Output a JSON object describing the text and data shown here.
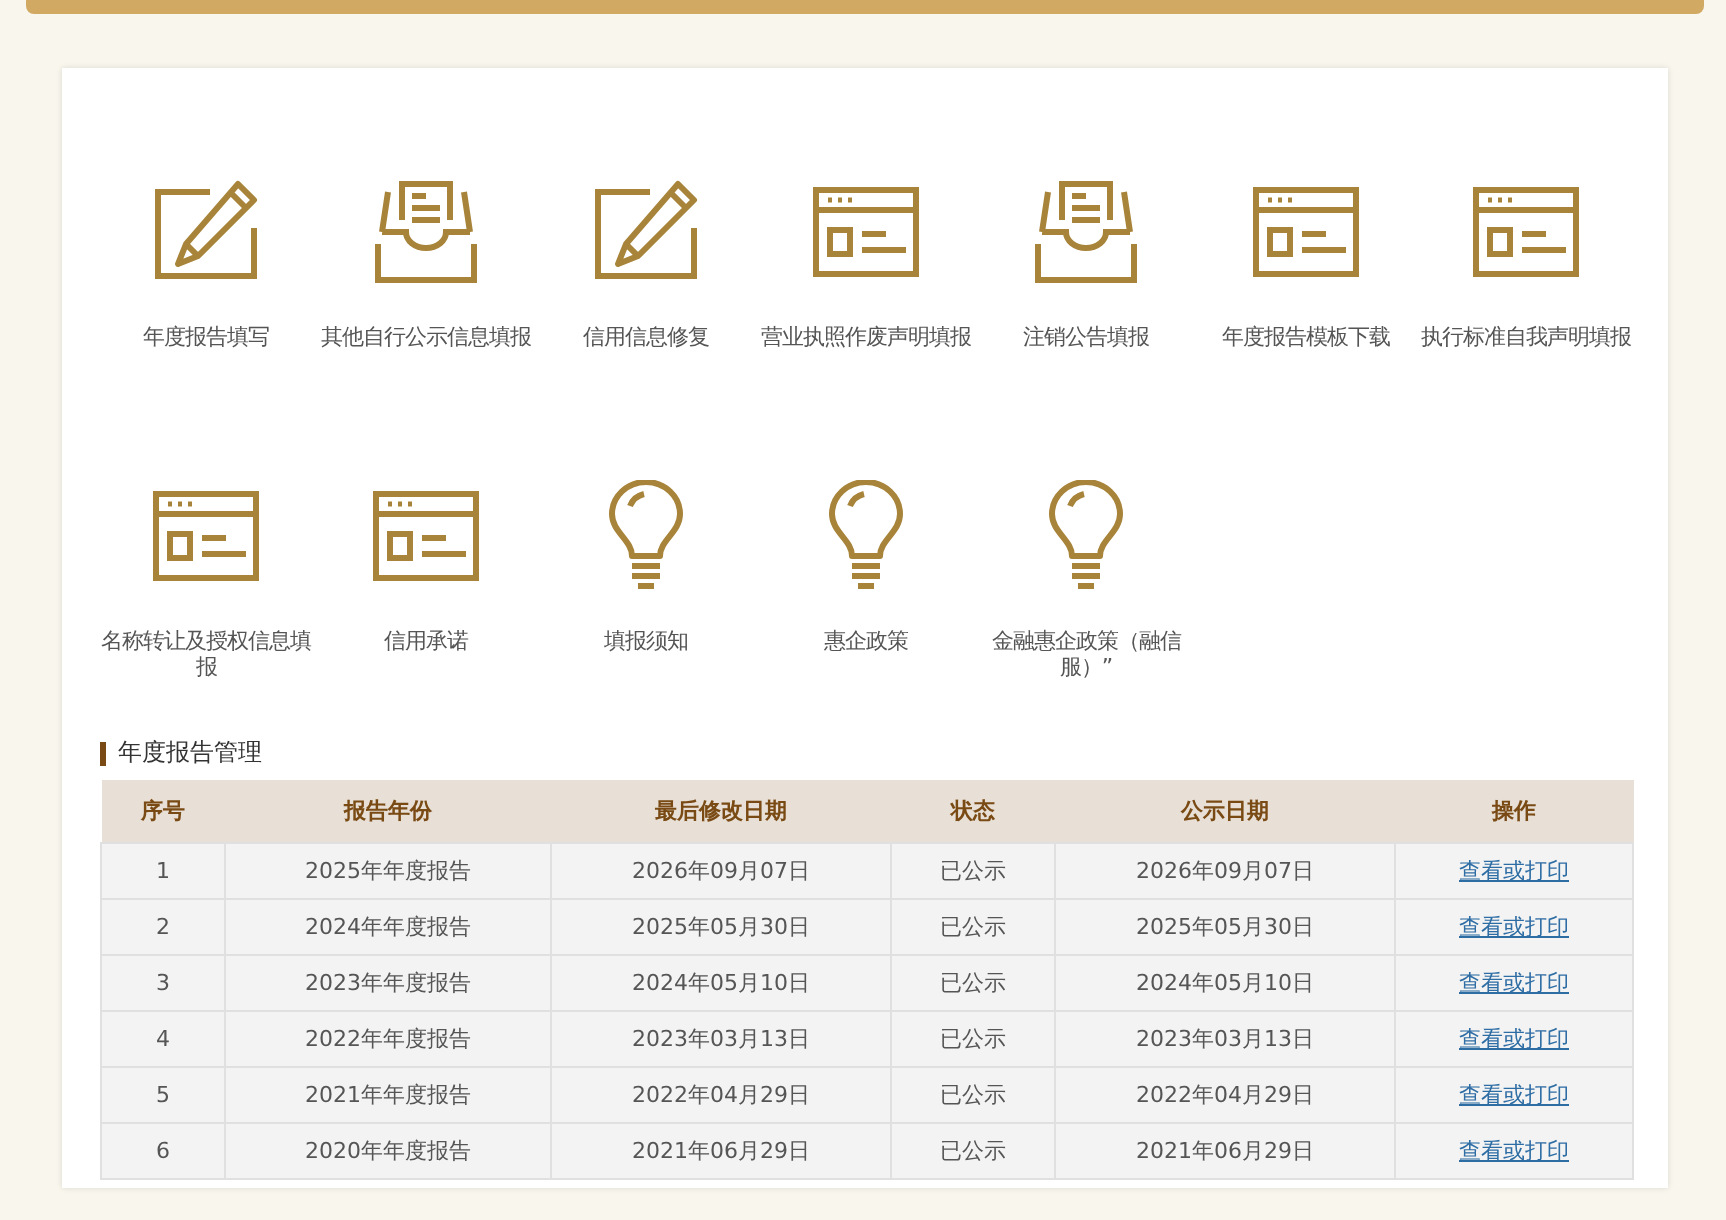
{
  "tiles": [
    {
      "kind": "edit",
      "label": "年度报告填写"
    },
    {
      "kind": "tray",
      "label": "其他自行公示信息填报"
    },
    {
      "kind": "edit",
      "label": "信用信息修复"
    },
    {
      "kind": "form",
      "label": "营业执照作废声明填报"
    },
    {
      "kind": "tray",
      "label": "注销公告填报"
    },
    {
      "kind": "form",
      "label": "年度报告模板下载"
    },
    {
      "kind": "form",
      "label": "执行标准自我声明填报"
    },
    {
      "kind": "form",
      "label": "名称转让及授权信息填报"
    },
    {
      "kind": "form",
      "label": "信用承诺"
    },
    {
      "kind": "bulb",
      "label": "填报须知"
    },
    {
      "kind": "bulb",
      "label": "惠企政策"
    },
    {
      "kind": "bulb",
      "label": "金融惠企政策（融信服）”"
    }
  ],
  "section_title": "年度报告管理",
  "table": {
    "columns": [
      "序号",
      "报告年份",
      "最后修改日期",
      "状态",
      "公示日期",
      "操作"
    ],
    "rows": [
      [
        "1",
        "2025年年度报告",
        "2026年09月07日",
        "已公示",
        "2026年09月07日",
        "查看或打印"
      ],
      [
        "2",
        "2024年年度报告",
        "2025年05月30日",
        "已公示",
        "2025年05月30日",
        "查看或打印"
      ],
      [
        "3",
        "2023年年度报告",
        "2024年05月10日",
        "已公示",
        "2024年05月10日",
        "查看或打印"
      ],
      [
        "4",
        "2022年年度报告",
        "2023年03月13日",
        "已公示",
        "2023年03月13日",
        "查看或打印"
      ],
      [
        "5",
        "2021年年度报告",
        "2022年04月29日",
        "已公示",
        "2022年04月29日",
        "查看或打印"
      ],
      [
        "6",
        "2020年年度报告",
        "2021年06月29日",
        "已公示",
        "2021年06月29日",
        "查看或打印"
      ]
    ]
  }
}
